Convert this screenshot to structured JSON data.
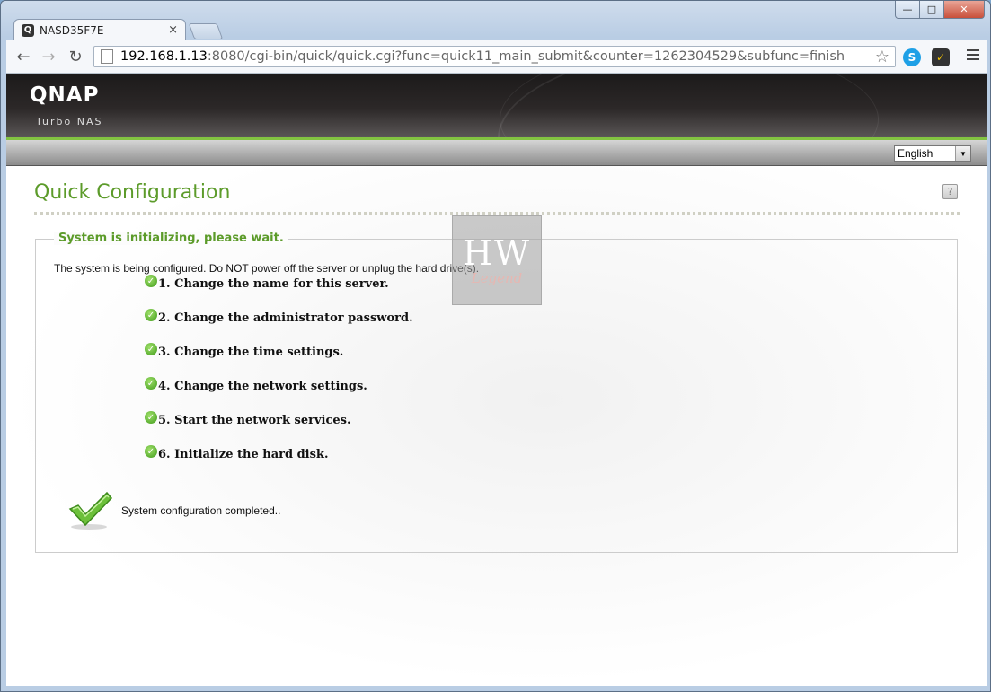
{
  "browser": {
    "tab_title": "NASD35F7E",
    "tab_close": "×",
    "url_host": "192.168.1.13",
    "url_rest": ":8080/cgi-bin/quick/quick.cgi?func=quick11_main_submit&counter=1262304529&subfunc=finish",
    "icons": [
      "back-icon",
      "forward-icon",
      "reload-icon",
      "page-icon",
      "star-icon",
      "skype-icon",
      "extension-icon",
      "menu-icon"
    ]
  },
  "header": {
    "logo": "QNAP",
    "sublogo": "Turbo NAS",
    "language": "English"
  },
  "main": {
    "title": "Quick Configuration",
    "help": "?",
    "section_title": "System is initializing, please wait.",
    "notice": "The system is being configured. Do NOT power off the server or unplug the hard drive(s).",
    "steps": [
      "1. Change the name for this server.",
      "2. Change the administrator password.",
      "3. Change the time settings.",
      "4. Change the network settings.",
      "5. Start the network services.",
      "6. Initialize the hard disk."
    ],
    "completed": "System configuration completed.."
  },
  "watermark": {
    "line1": "HW",
    "line2": "Legend"
  },
  "colors": {
    "accent_green": "#5c9b2a",
    "bar_green": "#82c341"
  }
}
